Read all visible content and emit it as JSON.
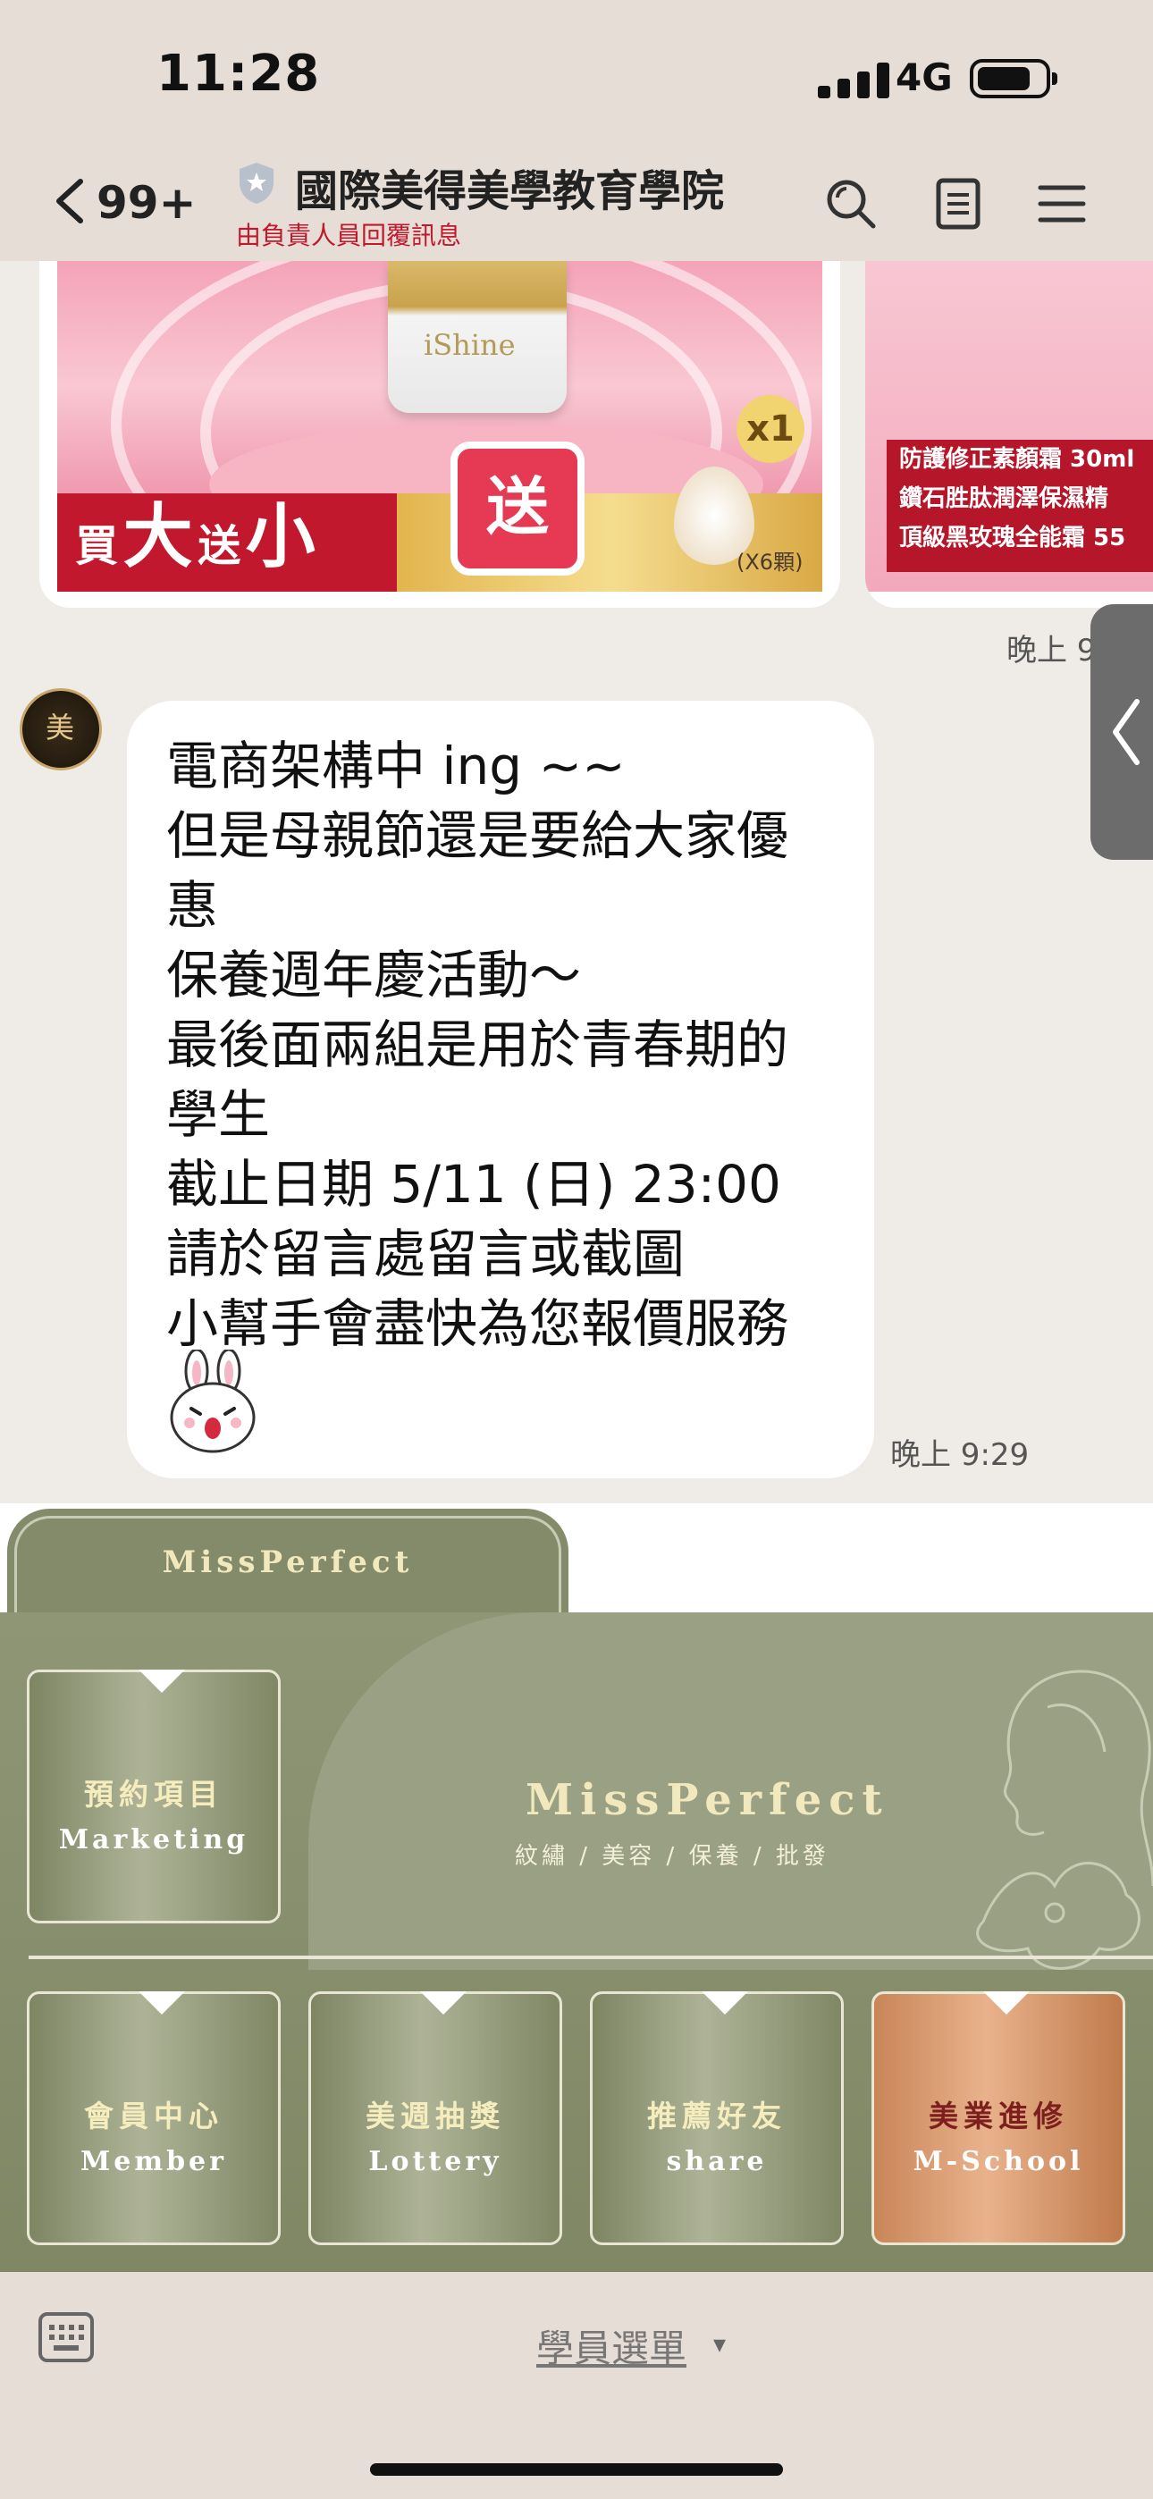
{
  "status": {
    "time": "11:28",
    "network": "4G"
  },
  "header": {
    "back_count": "99+",
    "title": "國際美得美學教育學院",
    "subtitle": "由負責人員回覆訊息",
    "icons": [
      "chevron-left-icon",
      "verified-shield-icon",
      "search-icon",
      "notes-icon",
      "menu-icon"
    ]
  },
  "chat": {
    "banner1": {
      "promo_small1": "買",
      "promo_big1": "大",
      "promo_small2": "送",
      "promo_big2": "小",
      "gift_label": "送",
      "qty": "x1",
      "brand": "iShine",
      "drop_label": "(X6顆)"
    },
    "banner2": {
      "lines": [
        "防護修正素顏霜 30ml",
        "鑽石胜肽潤澤保濕精",
        "頂級黑玫瑰全能霜 55"
      ]
    },
    "banner_time": "晚上 9",
    "message": {
      "lines": [
        "電商架構中 ing ~~",
        "但是母親節還是要給大家優",
        "惠",
        "保養週年慶活動～",
        "最後面兩組是用於青春期的",
        "學生",
        "截止日期 5/11 (日) 23:00",
        "請於留言處留言或截圖",
        "小幫手會盡快為您報價服務"
      ],
      "time": "晚上 9:29",
      "avatar_text": "美"
    }
  },
  "rich_menu": {
    "tab_label": "MissPerfect",
    "brand": "MissPerfect",
    "brand_sub": "紋繡 / 美容 / 保養 / 批發",
    "tiles": [
      {
        "zh": "預約項目",
        "en": "Marketing"
      },
      {
        "zh": "會員中心",
        "en": "Member"
      },
      {
        "zh": "美週抽獎",
        "en": "Lottery"
      },
      {
        "zh": "推薦好友",
        "en": "share"
      },
      {
        "zh": "美業進修",
        "en": "M-School"
      }
    ],
    "accent_color": "#8f9676",
    "highlight_color": "#c98558"
  },
  "bottom": {
    "menu_label": "學員選單",
    "arrow": "▾"
  }
}
